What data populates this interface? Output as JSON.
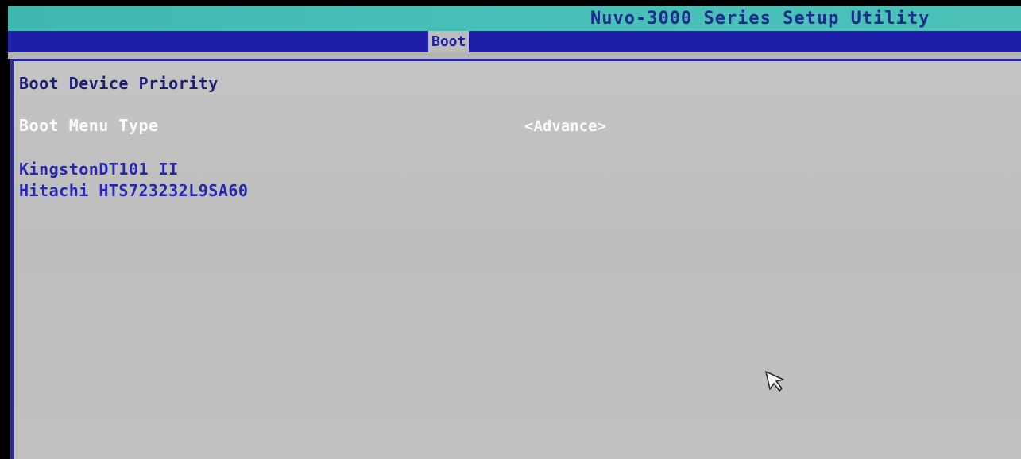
{
  "app": {
    "title": "Nuvo-3000 Series Setup Utility"
  },
  "menu": {
    "active_tab": "Boot"
  },
  "panel": {
    "section_title": "Boot Device Priority",
    "boot_menu_type": {
      "label": "Boot Menu Type",
      "value": "<Advance>"
    },
    "devices": [
      "KingstonDT101 II",
      "Hitachi HTS723232L9SA60"
    ]
  },
  "icons": {
    "cursor": "mouse-pointer-icon"
  },
  "colors": {
    "title_bar": "#47c0b8",
    "menu_bar": "#1e1ea8",
    "panel_bg": "#bfbfbf",
    "highlight_text": "#fafafa",
    "device_text": "#2626b4",
    "heading_text": "#1e1e74"
  }
}
